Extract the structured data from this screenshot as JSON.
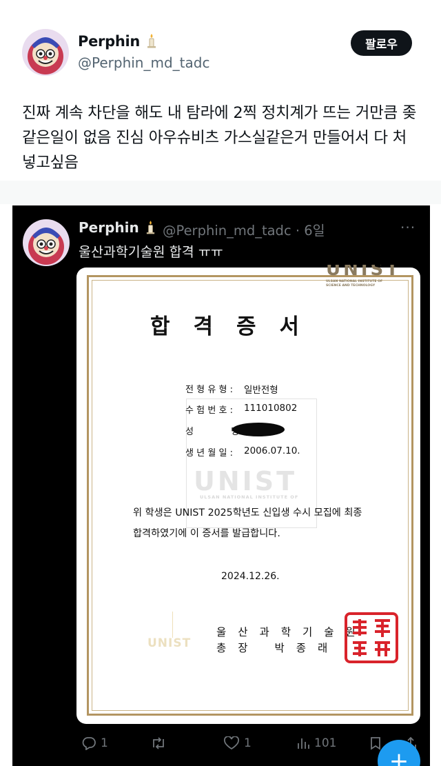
{
  "author": {
    "name": "Perphin",
    "handle": "@Perphin_md_tadc",
    "name_emoji": "candle-icon"
  },
  "follow_label": "팔로우",
  "tweet_text": "진짜 계속 차단을 해도 내 탐라에 2찍 정치계가 뜨는 거만큼 좆같은일이 없음 진심 아우슈비츠 가스실같은거 만들어서 다 처넣고싶음",
  "quoted": {
    "name": "Perphin",
    "handle_time": "@Perphin_md_tadc · 6일",
    "more": "···",
    "text": "울산과학기술원 합격 ㅠㅠ",
    "certificate": {
      "logo_text": "UNIST",
      "logo_sub": "ULSAN NATIONAL INSTITUTE OF SCIENCE AND TECHNOLOGY",
      "title": "합격증서",
      "fields": [
        {
          "label": "전형유형:",
          "value": "일반전형"
        },
        {
          "label": "수험번호:",
          "value": "111010802"
        },
        {
          "label": "성      명:",
          "value": ""
        },
        {
          "label": "생년월일:",
          "value": "2006.07.10."
        }
      ],
      "watermark": "UNIST",
      "watermark_sub": "ULSAN NATIONAL INSTITUTE OF",
      "body_line1": "위 학생은 UNIST 2025학년도 신입생 수시 모집에 최종",
      "body_line2": "합격하였기에 이 증서를 발급합니다.",
      "date": "2024.12.26.",
      "badge_text": "UNIST",
      "issuer_line1": "울산과학기술원",
      "issuer_line2": "총장 박종래"
    },
    "actions": {
      "replies": "1",
      "retweets": "",
      "likes": "1",
      "views": "101"
    }
  }
}
